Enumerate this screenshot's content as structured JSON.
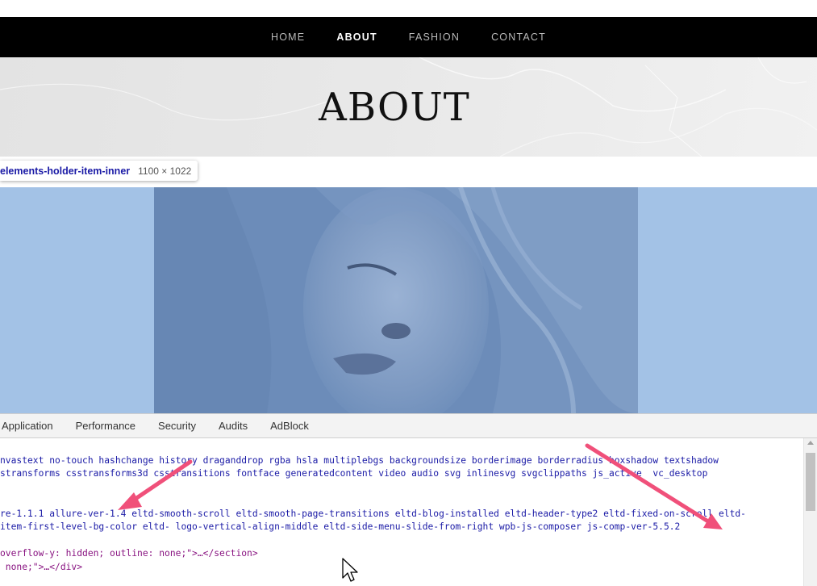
{
  "nav": {
    "items": [
      {
        "label": "HOME",
        "active": false
      },
      {
        "label": "ABOUT",
        "active": true
      },
      {
        "label": "FASHION",
        "active": false
      },
      {
        "label": "CONTACT",
        "active": false
      }
    ]
  },
  "hero": {
    "title": "ABOUT"
  },
  "inspector_tooltip": {
    "selector": "elements-holder-item-inner",
    "dimensions": "1100 × 1022"
  },
  "highlight": {
    "color": "#a3c2e6",
    "photo_description_icon": "portrait-photo"
  },
  "devtools": {
    "tabs": [
      "Application",
      "Performance",
      "Security",
      "Audits",
      "AdBlock"
    ],
    "code_lines": [
      "nvastext no-touch hashchange history draganddrop rgba hsla multiplebgs backgroundsize borderimage borderradius boxshadow textshadow",
      "stransforms csstransforms3d csstransitions fontface generatedcontent video audio svg inlinesvg svgclippaths js_active  vc_desktop",
      "",
      "re-1.1.1 allure-ver-1.4 eltd-smooth-scroll eltd-smooth-page-transitions eltd-blog-installed eltd-header-type2 eltd-fixed-on-scroll eltd-",
      "item-first-level-bg-color eltd- logo-vertical-align-middle eltd-side-menu-slide-from-right wpb-js-composer js-comp-ver-5.5.2",
      "",
      "overflow-y: hidden; outline: none;\">…</section>",
      " none;\">…</div>"
    ]
  },
  "colors": {
    "annotation_arrow": "#f0507a",
    "nav_bg": "#000000"
  }
}
